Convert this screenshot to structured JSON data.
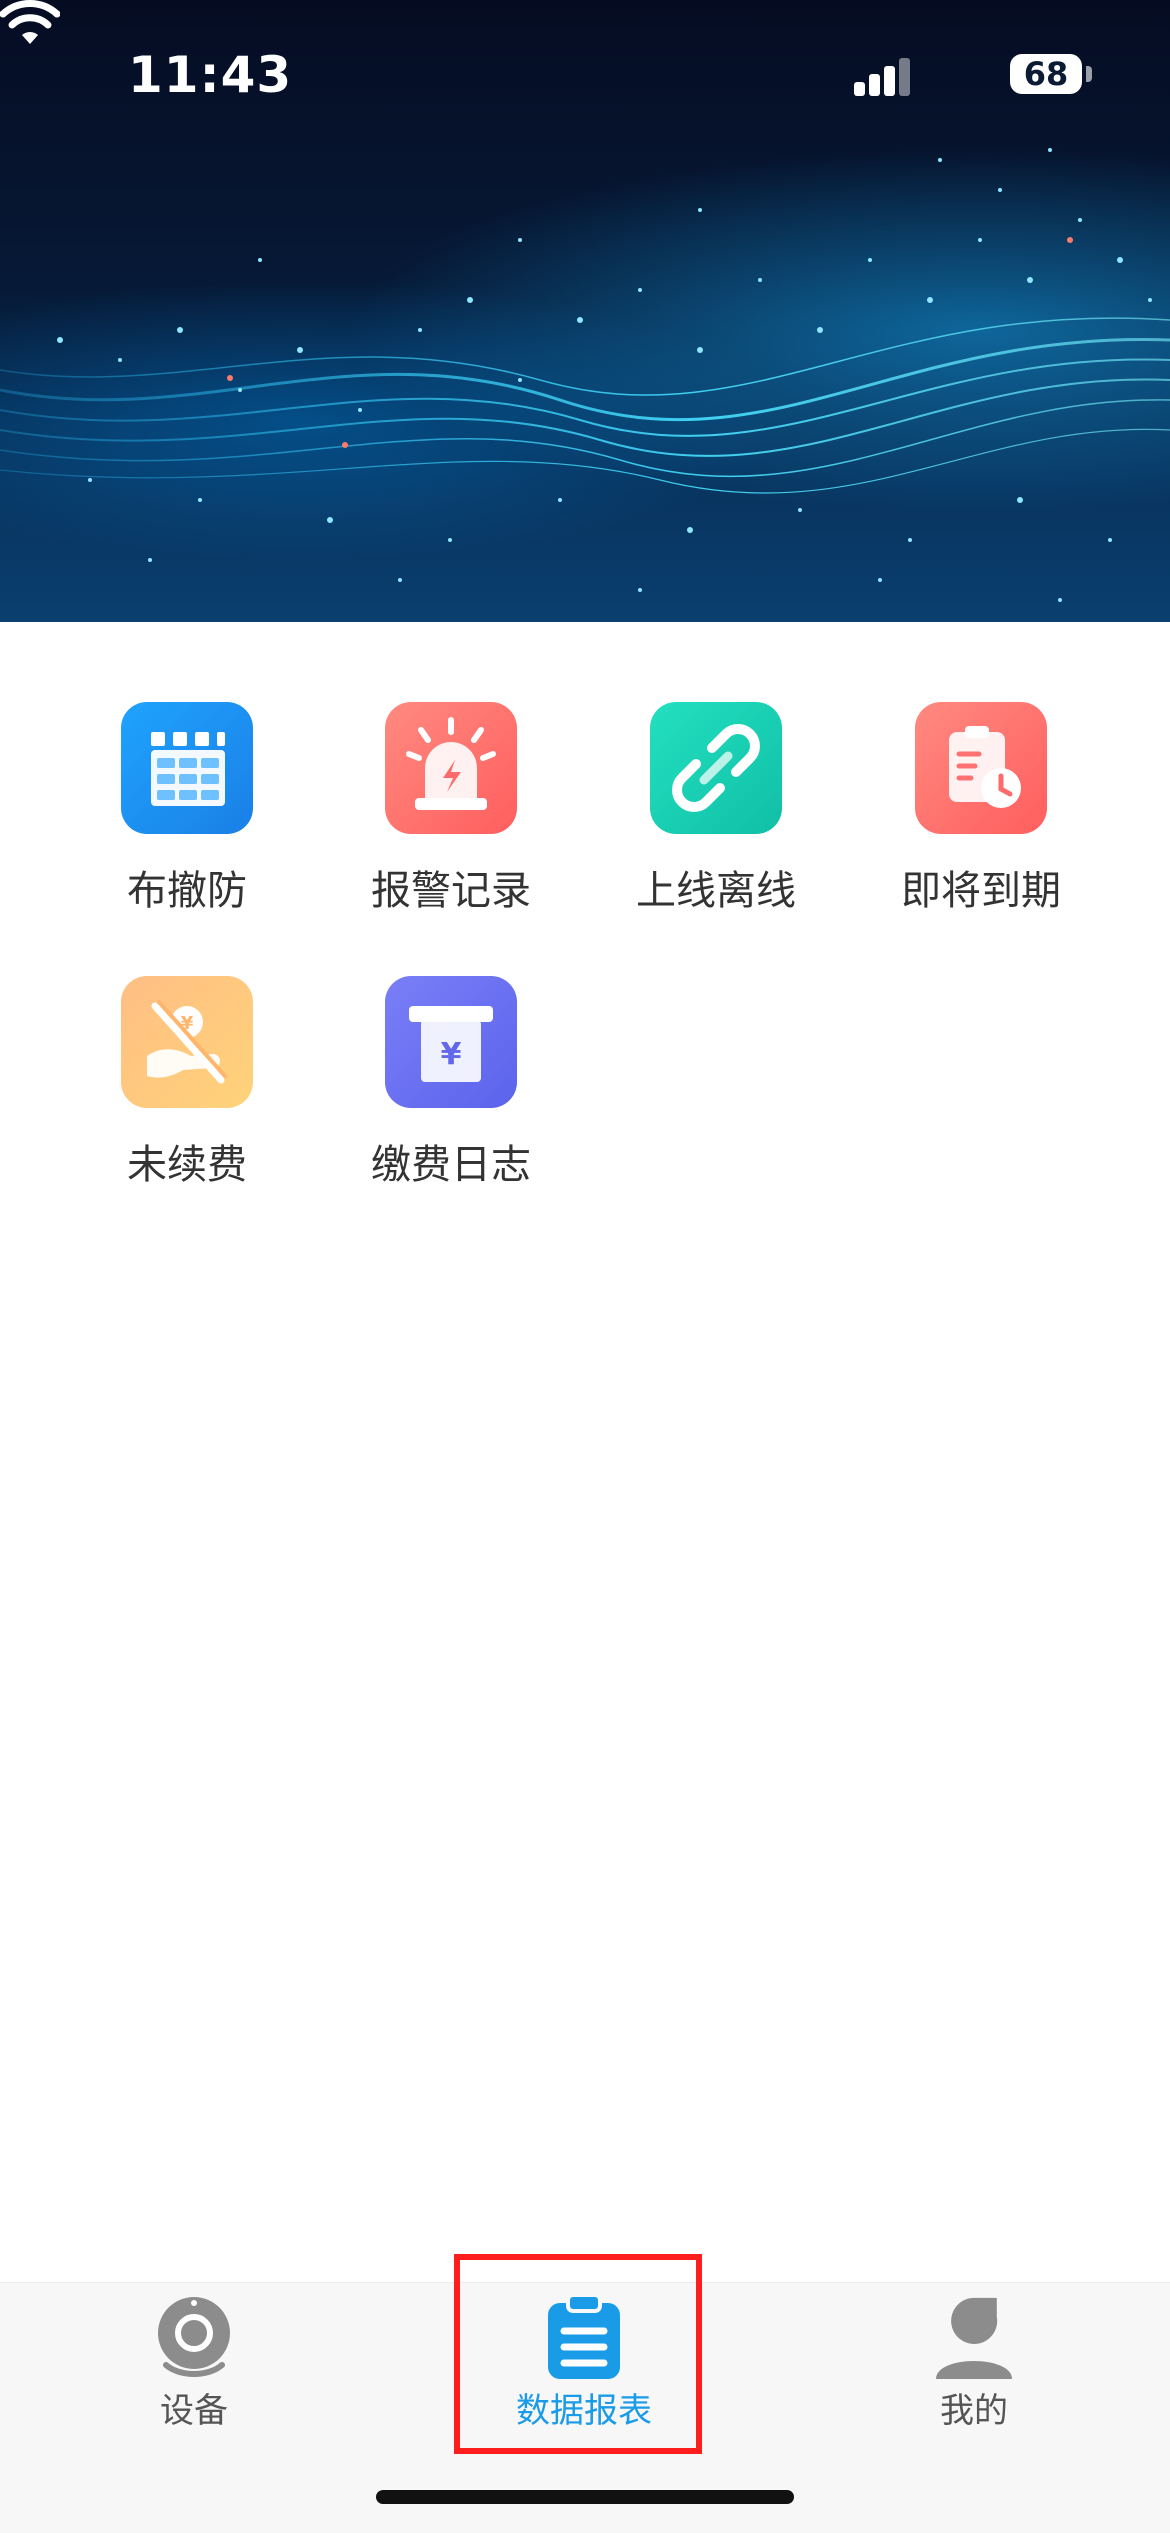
{
  "status_bar": {
    "time": "11:43",
    "battery": "68"
  },
  "menu": {
    "items": [
      {
        "label": "布撤防",
        "icon": "fortress-wall-icon",
        "color": "#1f8ff0"
      },
      {
        "label": "报警记录",
        "icon": "alarm-siren-icon",
        "color": "#ff6b6b"
      },
      {
        "label": "上线离线",
        "icon": "link-chain-icon",
        "color": "#17c9b3"
      },
      {
        "label": "即将到期",
        "icon": "clipboard-clock-icon",
        "color": "#ff6b6b"
      },
      {
        "label": "未续费",
        "icon": "no-payment-hand-icon",
        "color": "#ffb56b"
      },
      {
        "label": "缴费日志",
        "icon": "payment-slot-icon",
        "color": "#6b73f2"
      }
    ]
  },
  "tabbar": {
    "tabs": [
      {
        "label": "设备",
        "icon": "camera-icon",
        "active": false
      },
      {
        "label": "数据报表",
        "icon": "report-list-icon",
        "active": true
      },
      {
        "label": "我的",
        "icon": "user-profile-icon",
        "active": false
      }
    ],
    "active_color": "#1a9be8",
    "highlight_color": "#ff1e1e"
  }
}
